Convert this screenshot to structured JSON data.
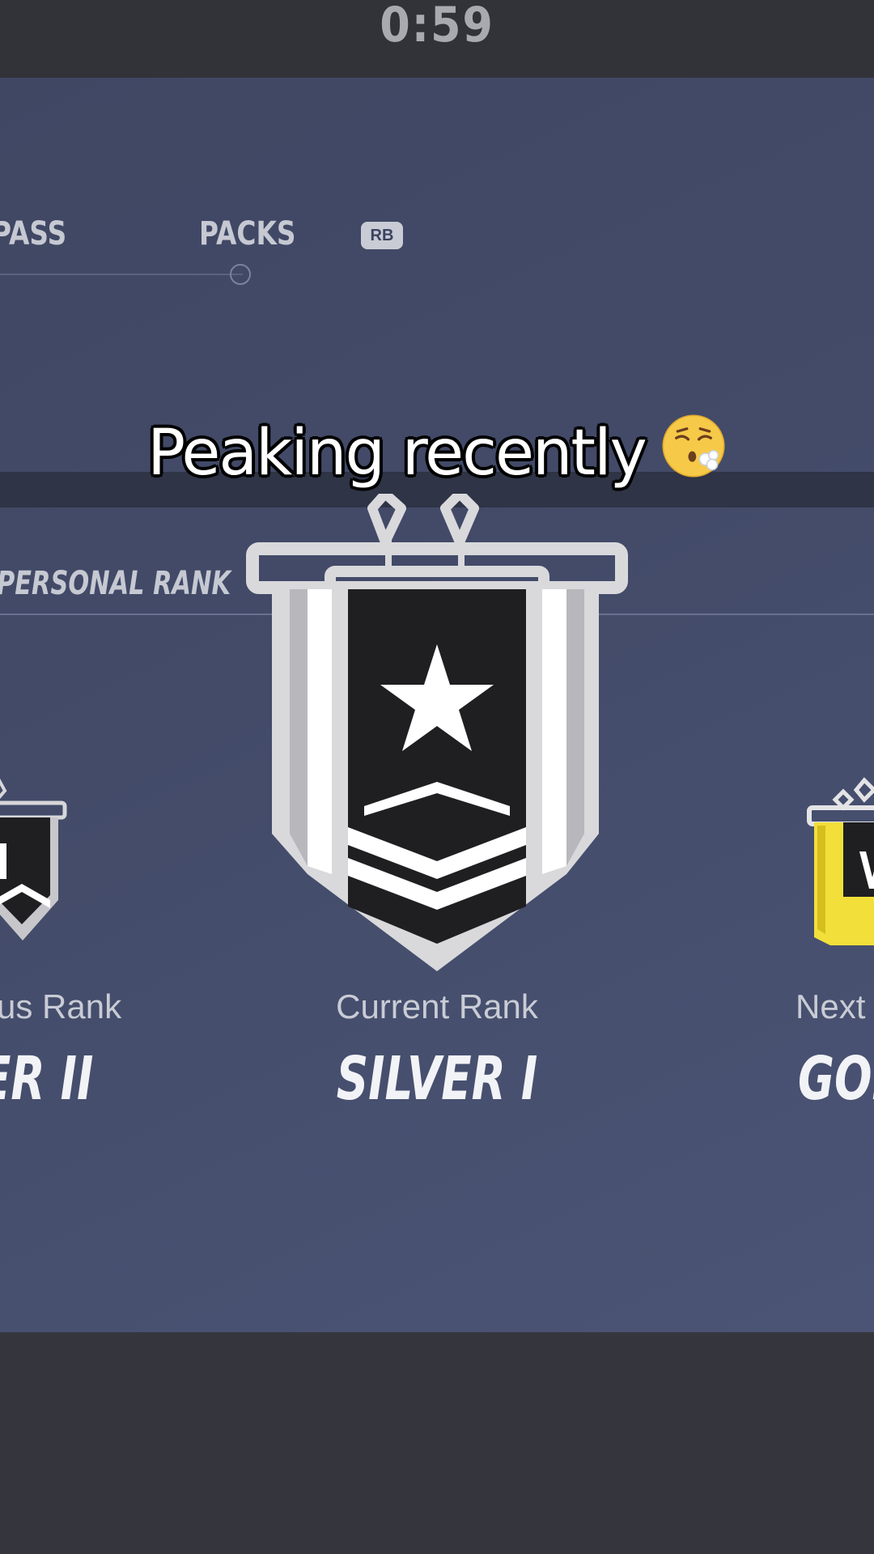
{
  "timer": "0:59",
  "tabs": [
    {
      "label": "PASS"
    },
    {
      "label": "PACKS"
    }
  ],
  "tab_button_hint": "RB",
  "caption": {
    "text": "Peaking recently",
    "emoji": "face-exhaling-emoji"
  },
  "section_title": "PERSONAL RANK",
  "ranks": {
    "previous": {
      "caption": "us Rank",
      "name": "ER II"
    },
    "current": {
      "caption": "Current Rank",
      "name": "SILVER I"
    },
    "next": {
      "caption": "Next",
      "name": "GOL"
    }
  },
  "colors": {
    "panel": "#434b69",
    "silver": "#d9d9dc",
    "gold": "#f2df3a"
  }
}
